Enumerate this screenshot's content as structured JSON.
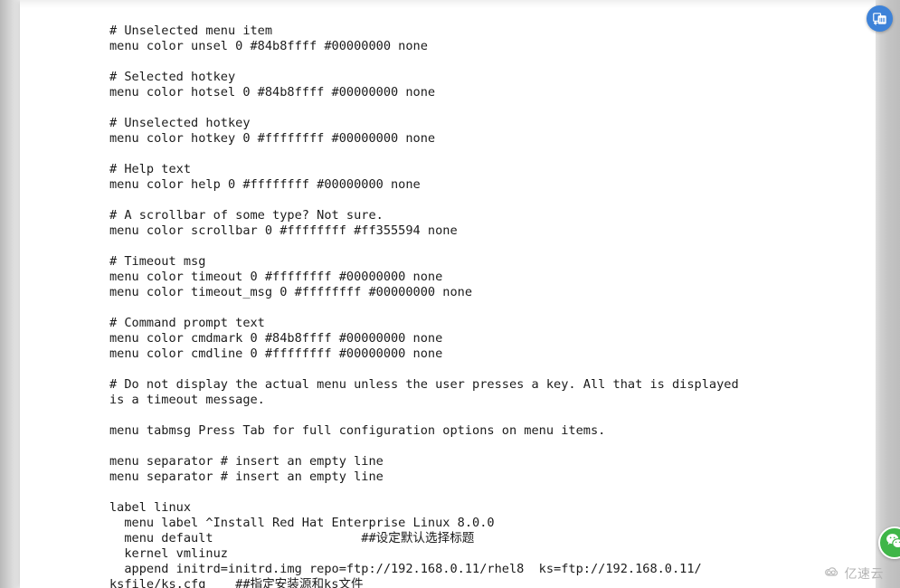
{
  "document": {
    "type": "syslinux-bootloader-config",
    "code_lines": [
      "# Unselected menu item",
      "menu color unsel 0 #84b8ffff #00000000 none",
      "",
      "# Selected hotkey",
      "menu color hotsel 0 #84b8ffff #00000000 none",
      "",
      "# Unselected hotkey",
      "menu color hotkey 0 #ffffffff #00000000 none",
      "",
      "# Help text",
      "menu color help 0 #ffffffff #00000000 none",
      "",
      "# A scrollbar of some type? Not sure.",
      "menu color scrollbar 0 #ffffffff #ff355594 none",
      "",
      "# Timeout msg",
      "menu color timeout 0 #ffffffff #00000000 none",
      "menu color timeout_msg 0 #ffffffff #00000000 none",
      "",
      "# Command prompt text",
      "menu color cmdmark 0 #84b8ffff #00000000 none",
      "menu color cmdline 0 #ffffffff #00000000 none",
      "",
      "# Do not display the actual menu unless the user presses a key. All that is displayed",
      "is a timeout message.",
      "",
      "menu tabmsg Press Tab for full configuration options on menu items.",
      "",
      "menu separator # insert an empty line",
      "menu separator # insert an empty line",
      "",
      "label linux",
      "  menu label ^Install Red Hat Enterprise Linux 8.0.0",
      "  menu default                    ##设定默认选择标题",
      "  kernel vmlinuz",
      "  append initrd=initrd.img repo=ftp://192.168.0.11/rhel8  ks=ftp://192.168.0.11/",
      "ksfile/ks.cfg    ##指定安装源和ks文件"
    ]
  },
  "floating_actions": {
    "share": {
      "icon": "share-document-icon",
      "color": "#3d82d8"
    },
    "wechat": {
      "icon": "wechat-icon",
      "color": "#3fb648"
    }
  },
  "watermark": {
    "icon": "cloud-icon",
    "text": "亿速云",
    "color": "#b4b4b4"
  }
}
